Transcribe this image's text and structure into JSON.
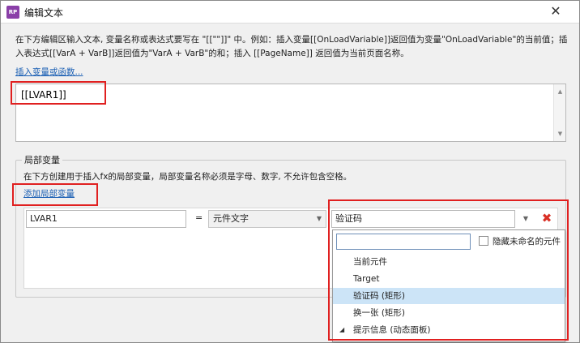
{
  "window": {
    "title": "编辑文本",
    "app_icon_text": "RP",
    "close_glyph": "✕"
  },
  "description": "在下方编辑区输入文本, 变量名称或表达式要写在 \"[[\"\"]]\" 中。例如：插入变量[[OnLoadVariable]]返回值为变量\"OnLoadVariable\"的当前值；插入表达式[[VarA + VarB]]返回值为\"VarA + VarB\"的和；插入 [[PageName]] 返回值为当前页面名称。",
  "insert_link": "插入变量或函数...",
  "editor": {
    "value": "[[LVAR1]]"
  },
  "local_vars": {
    "legend": "局部变量",
    "description": "在下方创建用于插入fx的局部变量，局部变量名称必须是字母、数字, 不允许包含空格。",
    "add_link": "添加局部变量",
    "row": {
      "name": "LVAR1",
      "equals": "=",
      "type": "元件文字",
      "widget": "验证码"
    }
  },
  "dropdown": {
    "search_placeholder": "",
    "hide_unnamed_label": "隐藏未命名的元件",
    "items": [
      {
        "label": "当前元件",
        "selected": false
      },
      {
        "label": "Target",
        "selected": false
      },
      {
        "label": "验证码 (矩形)",
        "selected": true
      },
      {
        "label": "换一张 (矩形)",
        "selected": false
      },
      {
        "label": "提示信息 (动态面板)",
        "selected": false,
        "expandable": true
      }
    ]
  },
  "colors": {
    "link": "#1a5fb4",
    "highlight": "#e02020",
    "selected_item": "#cce4f7",
    "delete": "#d93025"
  }
}
